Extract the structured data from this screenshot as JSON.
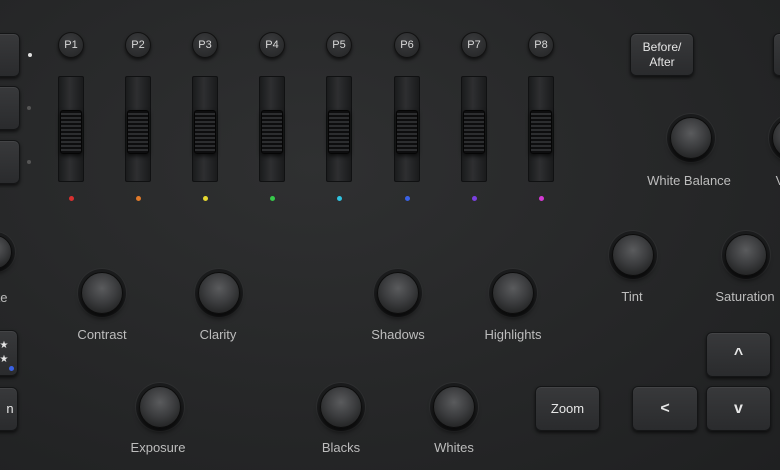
{
  "presets": [
    {
      "label": "P1",
      "color": "#d93030"
    },
    {
      "label": "P2",
      "color": "#e07a2a"
    },
    {
      "label": "P3",
      "color": "#e6d830"
    },
    {
      "label": "P4",
      "color": "#36c94a"
    },
    {
      "label": "P5",
      "color": "#2fc3e0"
    },
    {
      "label": "P6",
      "color": "#3a62e6"
    },
    {
      "label": "P7",
      "color": "#7a40e0"
    },
    {
      "label": "P8",
      "color": "#d43ad4"
    }
  ],
  "buttons": {
    "before_after": "Before/\nAfter",
    "zoom": "Zoom",
    "rating_stars": "★\n★",
    "left_arrow": "<",
    "up_arrow": "^",
    "down_arrow": "v"
  },
  "knobs": {
    "white_balance": "White Balance",
    "tint": "Tint",
    "saturation": "Saturation",
    "contrast": "Contrast",
    "clarity": "Clarity",
    "shadows": "Shadows",
    "highlights": "Highlights",
    "exposure": "Exposure",
    "blacks": "Blacks",
    "whites": "Whites",
    "partial_left": "te",
    "partial_right": "V"
  },
  "partial_left_button_text": "n"
}
